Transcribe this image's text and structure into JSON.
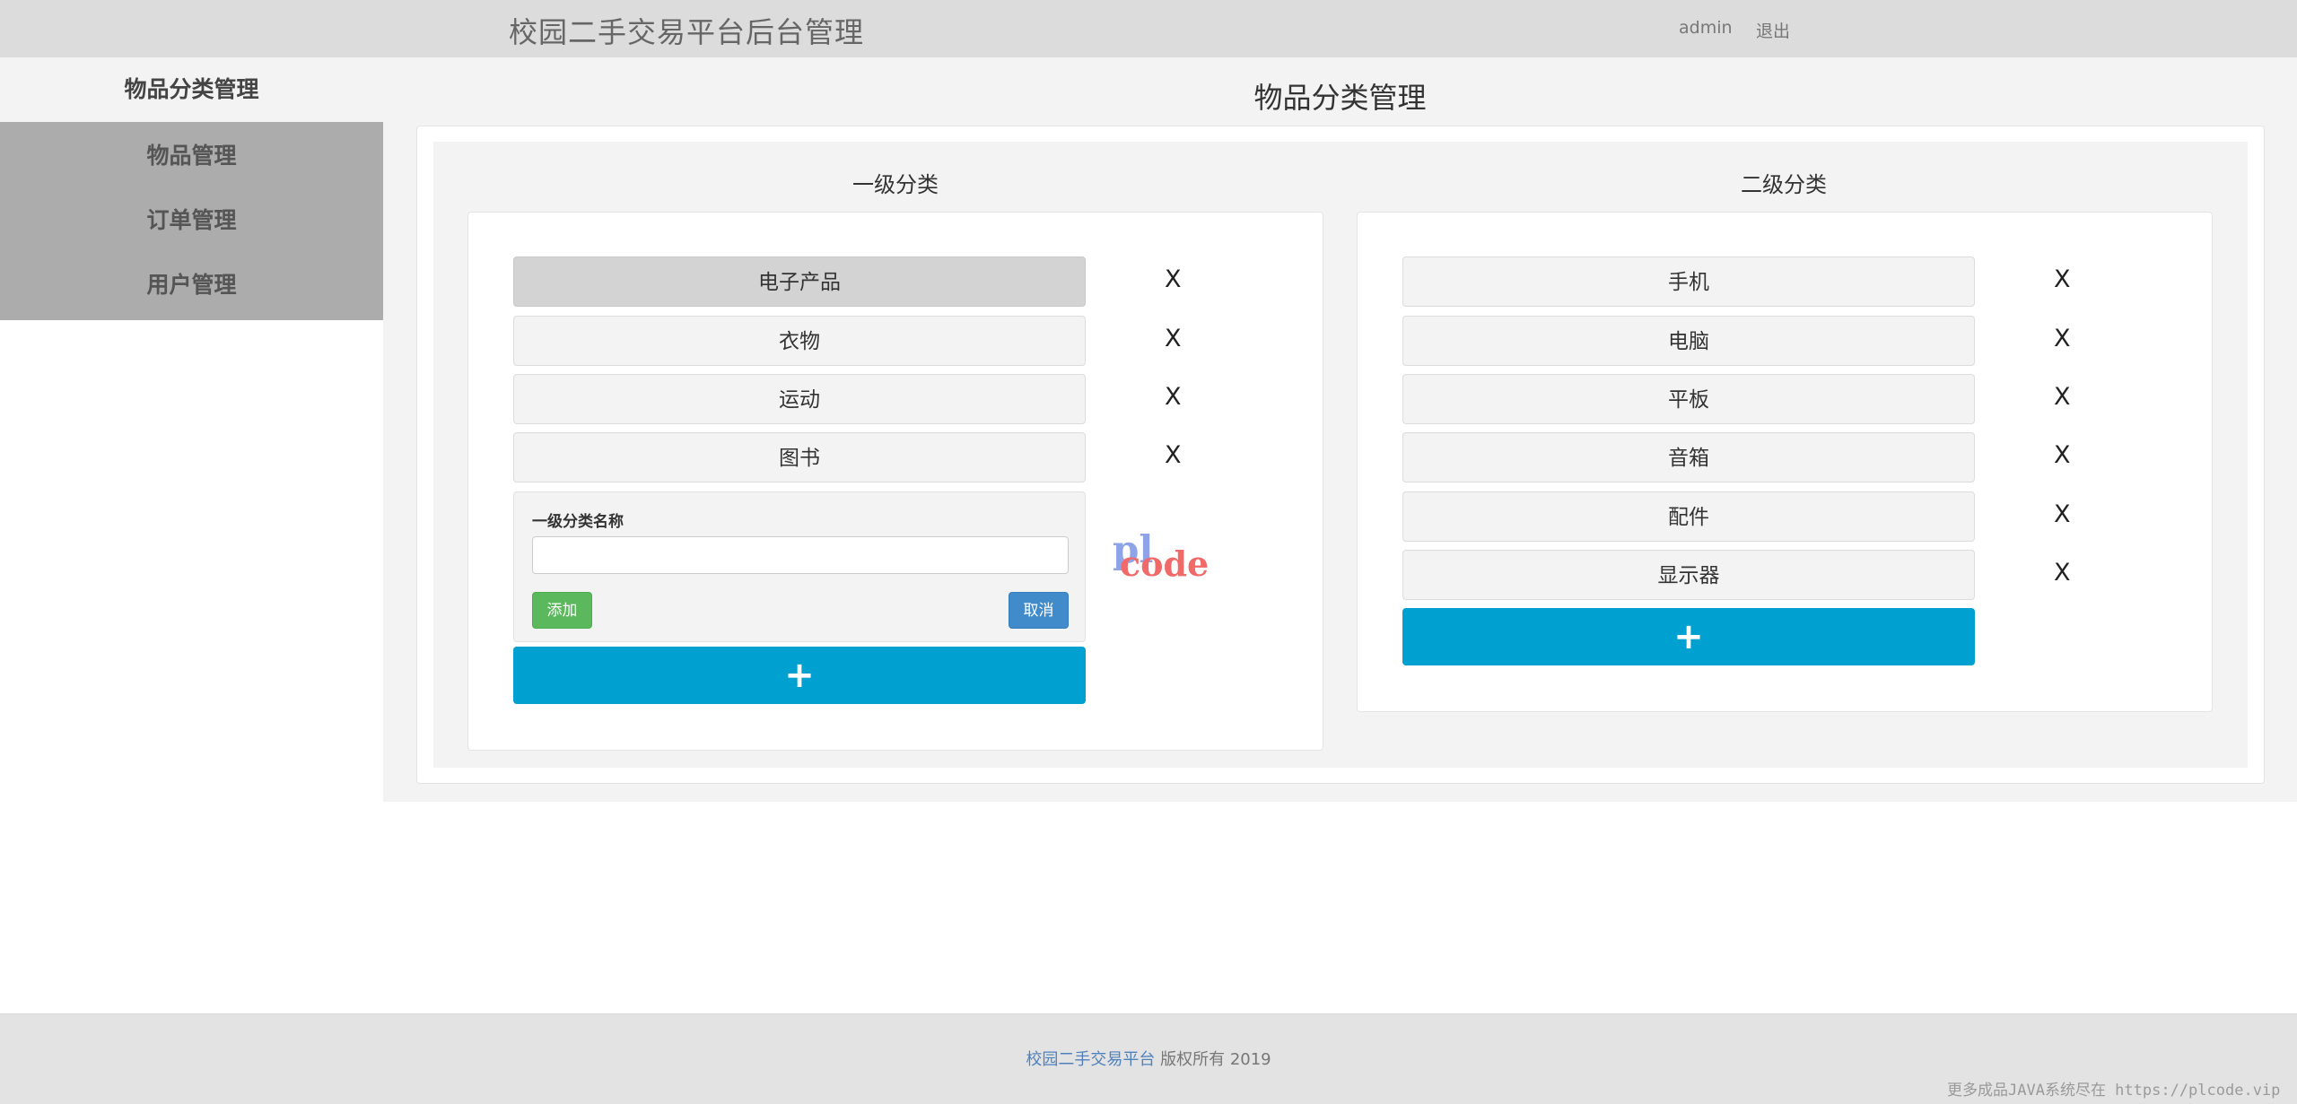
{
  "header": {
    "title": "校园二手交易平台后台管理",
    "user": "admin",
    "logout": "退出"
  },
  "sidebar": {
    "items": [
      {
        "label": "物品分类管理"
      },
      {
        "label": "物品管理"
      },
      {
        "label": "订单管理"
      },
      {
        "label": "用户管理"
      }
    ]
  },
  "main": {
    "page_title": "物品分类管理",
    "level1": {
      "title": "一级分类",
      "items": [
        {
          "label": "电子产品",
          "delete": "X"
        },
        {
          "label": "衣物",
          "delete": "X"
        },
        {
          "label": "运动",
          "delete": "X"
        },
        {
          "label": "图书",
          "delete": "X"
        }
      ],
      "form": {
        "label": "一级分类名称",
        "value": "",
        "add": "添加",
        "cancel": "取消"
      },
      "add_symbol": "+"
    },
    "level2": {
      "title": "二级分类",
      "items": [
        {
          "label": "手机",
          "delete": "X"
        },
        {
          "label": "电脑",
          "delete": "X"
        },
        {
          "label": "平板",
          "delete": "X"
        },
        {
          "label": "音箱",
          "delete": "X"
        },
        {
          "label": "配件",
          "delete": "X"
        },
        {
          "label": "显示器",
          "delete": "X"
        }
      ],
      "add_symbol": "+"
    }
  },
  "watermark": {
    "part1": "pl",
    "part2": "code"
  },
  "footer": {
    "brand": "校园二手交易平台",
    "text": "版权所有  2019"
  },
  "corner_note": "更多成品JAVA系统尽在 https://plcode.vip"
}
